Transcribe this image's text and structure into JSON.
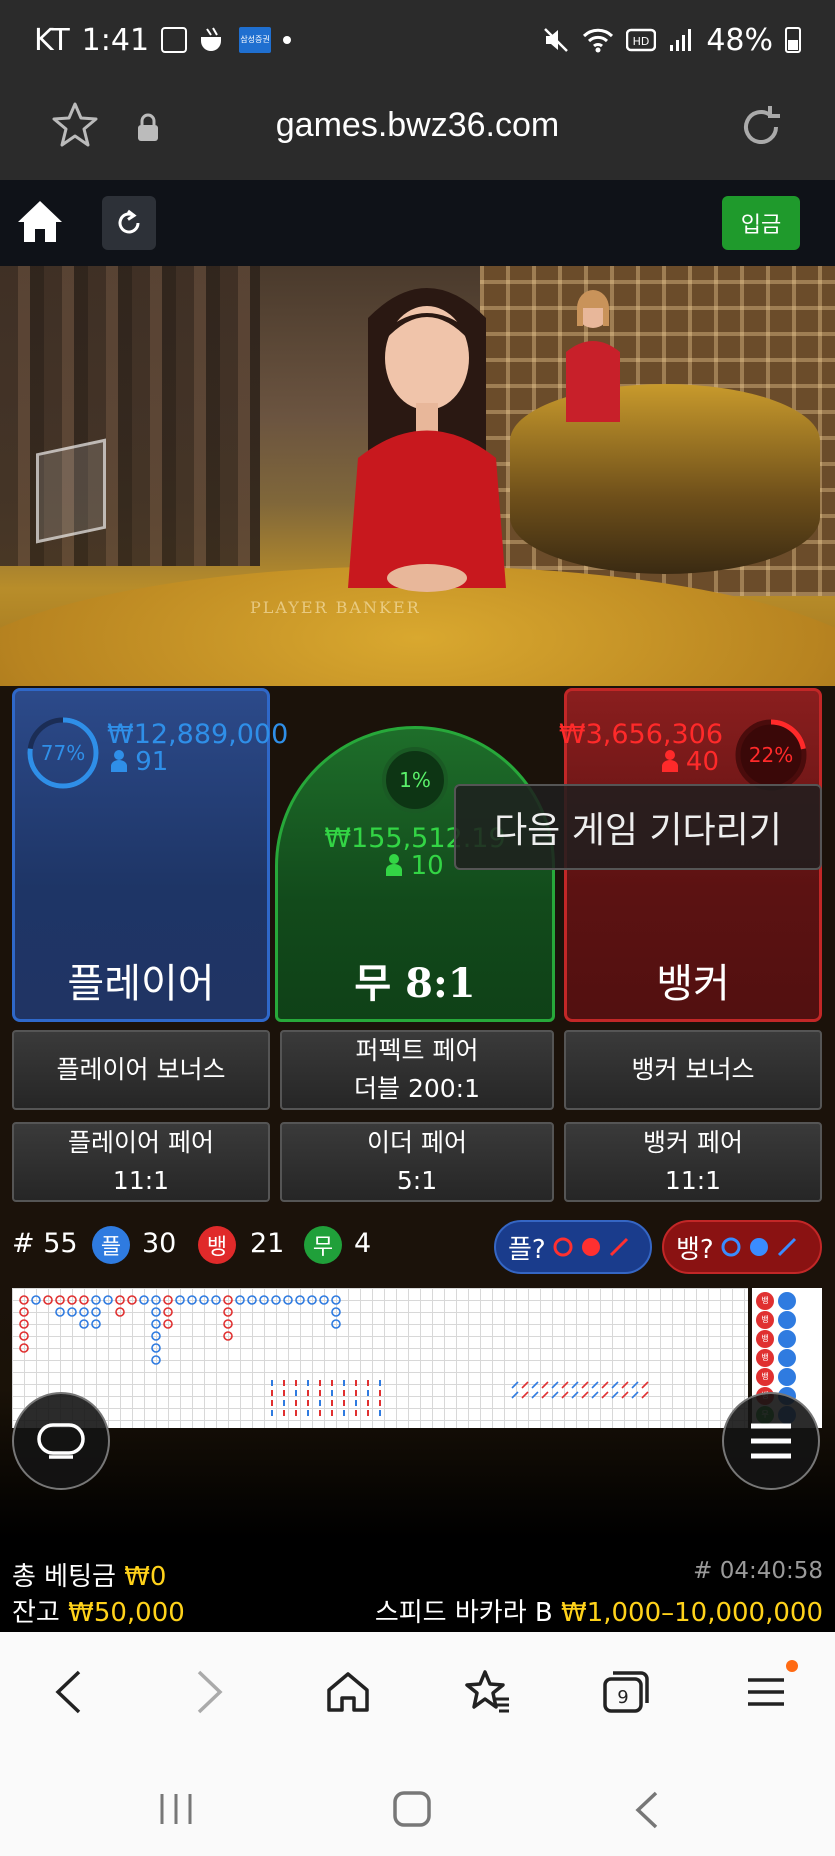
{
  "status_bar": {
    "carrier": "KT",
    "time": "1:41",
    "battery": "48%",
    "icons_left": [
      "gallery-icon",
      "cup-icon",
      "samsung-securities-icon",
      "dot-icon"
    ],
    "samsung_label": "삼성증권",
    "icons_right": [
      "mute-icon",
      "wifi-icon",
      "hd-icon",
      "signal-icon",
      "battery-icon"
    ]
  },
  "browser": {
    "url": "games.bwz36.com"
  },
  "app_header": {
    "deposit_label": "입금"
  },
  "video": {
    "felt_text": "PLAYER        BANKER"
  },
  "bets": {
    "player": {
      "percent": "77%",
      "amount": "₩12,889,000",
      "users": "91",
      "label": "플레이어",
      "ratio": 0.77,
      "color": "#2f8fe8"
    },
    "banker": {
      "percent": "22%",
      "amount": "₩3,656,306",
      "users": "40",
      "label": "뱅커",
      "ratio": 0.22,
      "color": "#ff2a2a"
    },
    "tie": {
      "percent": "1%",
      "amount": "₩155,512.19",
      "users": "10",
      "label": "무 8:1",
      "color": "#33d545"
    },
    "waiting_text": "다음 게임 기다리기"
  },
  "side_bets": {
    "player_bonus": "플레이어 보너스",
    "perfect_pair_1": "퍼펙트 페어",
    "perfect_pair_2": "더블 200:1",
    "banker_bonus": "뱅커 보너스",
    "player_pair_1": "플레이어 페어",
    "player_pair_2": "11:1",
    "either_pair_1": "이더 페어",
    "either_pair_2": "5:1",
    "banker_pair_1": "뱅커 페어",
    "banker_pair_2": "11:1"
  },
  "stats": {
    "round": "# 55",
    "player_badge": "플",
    "player_count": "30",
    "banker_badge": "뱅",
    "banker_count": "21",
    "tie_badge": "무",
    "tie_count": "4",
    "player_predict": "플?",
    "banker_predict": "뱅?"
  },
  "road_side_labels": [
    "뱅",
    "뱅",
    "뱅",
    "뱅",
    "뱅",
    "뱅",
    "무"
  ],
  "footer": {
    "total_bet_label": "총 베팅금",
    "total_bet_value": "₩0",
    "game_id": "# 04:40:58",
    "balance_label": "잔고",
    "balance_value": "₩50,000",
    "table_name": "스피드 바카라 B",
    "limits": "₩1,000–10,000,000"
  },
  "browser_nav": {
    "tabs_count": "9"
  }
}
